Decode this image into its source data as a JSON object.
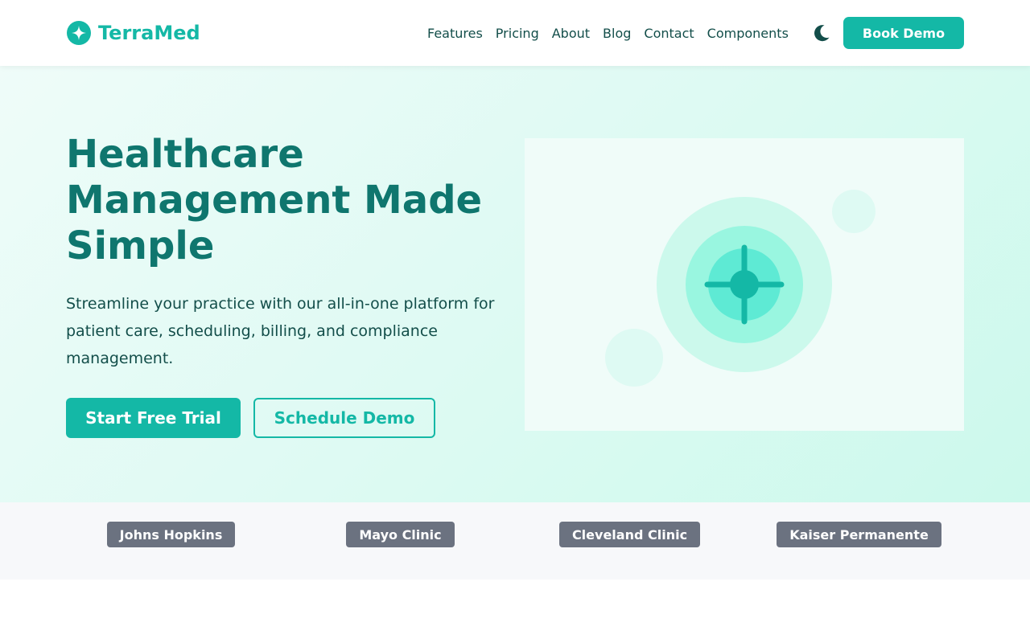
{
  "brand": {
    "name": "TerraMed",
    "icon": "sparkle-logo-icon",
    "accent": "#14b8a6"
  },
  "nav": {
    "items": [
      {
        "label": "Features"
      },
      {
        "label": "Pricing"
      },
      {
        "label": "About"
      },
      {
        "label": "Blog"
      },
      {
        "label": "Contact"
      },
      {
        "label": "Components"
      }
    ],
    "theme_toggle_icon": "moon-icon",
    "cta_label": "Book Demo"
  },
  "hero": {
    "title": "Healthcare Management Made Simple",
    "description": "Streamline your practice with our all-in-one platform for patient care, scheduling, billing, and compliance management.",
    "primary_cta": "Start Free Trial",
    "secondary_cta": "Schedule Demo",
    "illustration_icon": "medical-cross-icon"
  },
  "partners": [
    {
      "label": "Johns Hopkins"
    },
    {
      "label": "Mayo Clinic"
    },
    {
      "label": "Cleveland Clinic"
    },
    {
      "label": "Kaiser Permanente"
    }
  ],
  "colors": {
    "primary": "#14b8a6",
    "heading": "#0f766e",
    "text": "#134e4a",
    "partner_badge": "#6b7280"
  }
}
